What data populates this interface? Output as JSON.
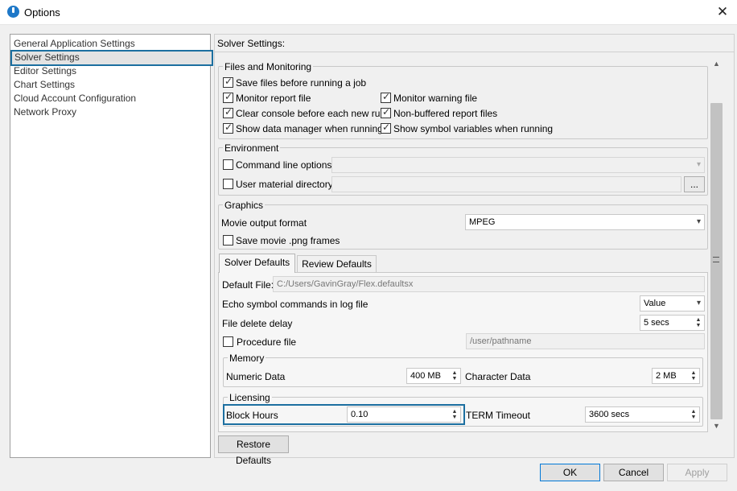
{
  "window": {
    "title": "Options",
    "close_glyph": "✕"
  },
  "sidebar": {
    "items": [
      {
        "label": "General Application Settings"
      },
      {
        "label": "Solver Settings"
      },
      {
        "label": "Editor Settings"
      },
      {
        "label": "Chart Settings"
      },
      {
        "label": "Cloud Account Configuration"
      },
      {
        "label": "Network Proxy"
      }
    ]
  },
  "main": {
    "header": "Solver Settings:",
    "files_monitoring": {
      "title": "Files and Monitoring",
      "options": [
        {
          "label": "Save files before running a job",
          "checked": true
        },
        {
          "label": "Monitor report file",
          "checked": true
        },
        {
          "label": "Monitor warning file",
          "checked": true
        },
        {
          "label": "Clear console before each new run",
          "checked": true
        },
        {
          "label": "Non-buffered report files",
          "checked": true
        },
        {
          "label": "Show data manager when running",
          "checked": true
        },
        {
          "label": "Show symbol variables when running",
          "checked": true
        }
      ]
    },
    "environment": {
      "title": "Environment",
      "command_line_label": "Command line options",
      "command_line_value": "",
      "user_material_label": "User material directory",
      "user_material_value": "",
      "browse_label": "..."
    },
    "graphics": {
      "title": "Graphics",
      "movie_format_label": "Movie output format",
      "movie_format_value": "MPEG",
      "save_png_label": "Save movie .png frames"
    },
    "tabs": [
      {
        "label": "Solver Defaults"
      },
      {
        "label": "Review Defaults"
      }
    ],
    "solver_defaults": {
      "default_file_label": "Default File:",
      "default_file_value": "C:/Users/GavinGray/Flex.defaultsx",
      "echo_label": "Echo symbol commands in log file",
      "echo_value": "Value",
      "delete_delay_label": "File delete delay",
      "delete_delay_value": "5 secs",
      "procedure_label": "Procedure file",
      "procedure_placeholder": "/user/pathname",
      "memory": {
        "title": "Memory",
        "numeric_label": "Numeric Data",
        "numeric_value": "400 MB",
        "character_label": "Character Data",
        "character_value": "2 MB"
      },
      "licensing": {
        "title": "Licensing",
        "block_hours_label": "Block Hours",
        "block_hours_value": "0.10",
        "term_timeout_label": "TERM Timeout",
        "term_timeout_value": "3600 secs"
      }
    },
    "restore_defaults": "Restore Defaults"
  },
  "footer": {
    "ok": "OK",
    "cancel": "Cancel",
    "apply": "Apply"
  },
  "colors": {
    "accent": "#1c6fa0",
    "selected_bg": "#e3e3e3",
    "app_icon": "#1e78c8"
  }
}
